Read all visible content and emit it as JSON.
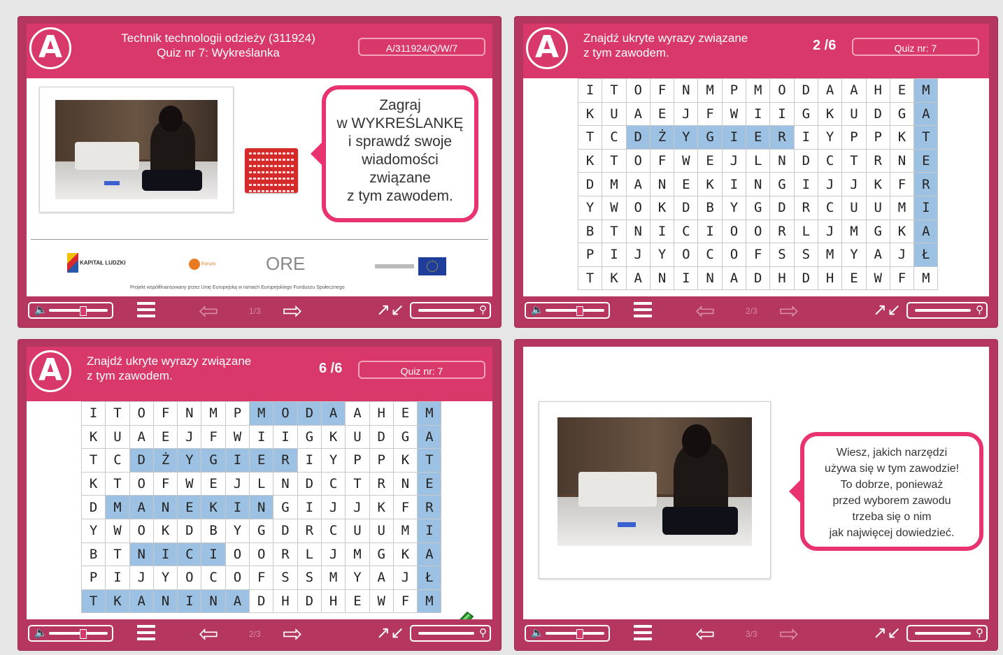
{
  "slides": [
    {
      "title_line1": "Technik technologii odzieży (311924)",
      "title_line2": "Quiz nr 7: Wykreślanka",
      "code": "A/311924/Q/W/7",
      "bubble_lines": [
        "Zagraj",
        "w WYKREŚLANKĘ",
        "i sprawdź swoje",
        "wiadomości",
        "związane",
        "z tym zawodem."
      ],
      "sponsors": [
        "KAPITAŁ LUDZKI",
        "Forum",
        "ORE"
      ],
      "footnote": "Projekt współfinansowany przez Unię Europejską w ramach Europejskiego Funduszu Społecznego",
      "page": "1/3"
    },
    {
      "title_line1": "Znajdź ukryte wyrazy związane",
      "title_line2": "z tym zawodem.",
      "counter": "2 /6",
      "quiz": "Quiz nr: 7",
      "page": "2/3"
    },
    {
      "title_line1": "Znajdź ukryte wyrazy związane",
      "title_line2": "z tym zawodem.",
      "counter": "6 /6",
      "quiz": "Quiz nr: 7",
      "page": "2/3"
    },
    {
      "bubble_lines": [
        "Wiesz, jakich narzędzi",
        "używa się w tym zawodzie!",
        "To dobrze, ponieważ",
        "przed wyborem zawodu",
        "trzeba się o nim",
        "jak najwięcej dowiedzieć."
      ],
      "page": "3/3"
    }
  ],
  "grid": [
    [
      "I",
      "T",
      "O",
      "F",
      "N",
      "M",
      "P",
      "M",
      "O",
      "D",
      "A",
      "A",
      "H",
      "E",
      "M"
    ],
    [
      "K",
      "U",
      "A",
      "E",
      "J",
      "F",
      "W",
      "I",
      "I",
      "G",
      "K",
      "U",
      "D",
      "G",
      "A"
    ],
    [
      "T",
      "C",
      "D",
      "Ż",
      "Y",
      "G",
      "I",
      "E",
      "R",
      "I",
      "Y",
      "P",
      "P",
      "K",
      "T"
    ],
    [
      "K",
      "T",
      "O",
      "F",
      "W",
      "E",
      "J",
      "L",
      "N",
      "D",
      "C",
      "T",
      "R",
      "N",
      "E"
    ],
    [
      "D",
      "M",
      "A",
      "N",
      "E",
      "K",
      "I",
      "N",
      "G",
      "I",
      "J",
      "J",
      "K",
      "F",
      "R"
    ],
    [
      "Y",
      "W",
      "O",
      "K",
      "D",
      "B",
      "Y",
      "G",
      "D",
      "R",
      "C",
      "U",
      "U",
      "M",
      "I"
    ],
    [
      "B",
      "T",
      "N",
      "I",
      "C",
      "I",
      "O",
      "O",
      "R",
      "L",
      "J",
      "M",
      "G",
      "K",
      "A"
    ],
    [
      "P",
      "I",
      "J",
      "Y",
      "O",
      "C",
      "O",
      "F",
      "S",
      "S",
      "M",
      "Y",
      "A",
      "J",
      "Ł"
    ],
    [
      "T",
      "K",
      "A",
      "N",
      "I",
      "N",
      "A",
      "D",
      "H",
      "D",
      "H",
      "E",
      "W",
      "F",
      "M"
    ]
  ],
  "highlight_slide2": [
    "2-2",
    "2-3",
    "2-4",
    "2-5",
    "2-6",
    "2-7",
    "2-8",
    "0-14",
    "1-14",
    "2-14",
    "3-14",
    "4-14",
    "5-14",
    "6-14",
    "7-14"
  ],
  "highlight_slide3": [
    "0-7",
    "0-8",
    "0-9",
    "0-10",
    "0-14",
    "1-14",
    "2-14",
    "3-14",
    "4-14",
    "5-14",
    "6-14",
    "7-14",
    "8-14",
    "2-2",
    "2-3",
    "2-4",
    "2-5",
    "2-6",
    "2-7",
    "2-8",
    "4-1",
    "4-2",
    "4-3",
    "4-4",
    "4-5",
    "4-6",
    "4-7",
    "6-2",
    "6-3",
    "6-4",
    "6-5",
    "8-0",
    "8-1",
    "8-2",
    "8-3",
    "8-4",
    "8-5",
    "8-6"
  ],
  "colors": {
    "header": "#d9386a",
    "frame": "#b5375f",
    "bubble_border": "#e8336e",
    "highlight": "#9dc1e2",
    "check": "#2f9e2f"
  },
  "icons": [
    "logo-a-icon",
    "speaker-icon",
    "menu-icon",
    "arrow-left-icon",
    "arrow-right-icon",
    "fullscreen-icon",
    "magnifier-icon",
    "checkmark-icon"
  ]
}
